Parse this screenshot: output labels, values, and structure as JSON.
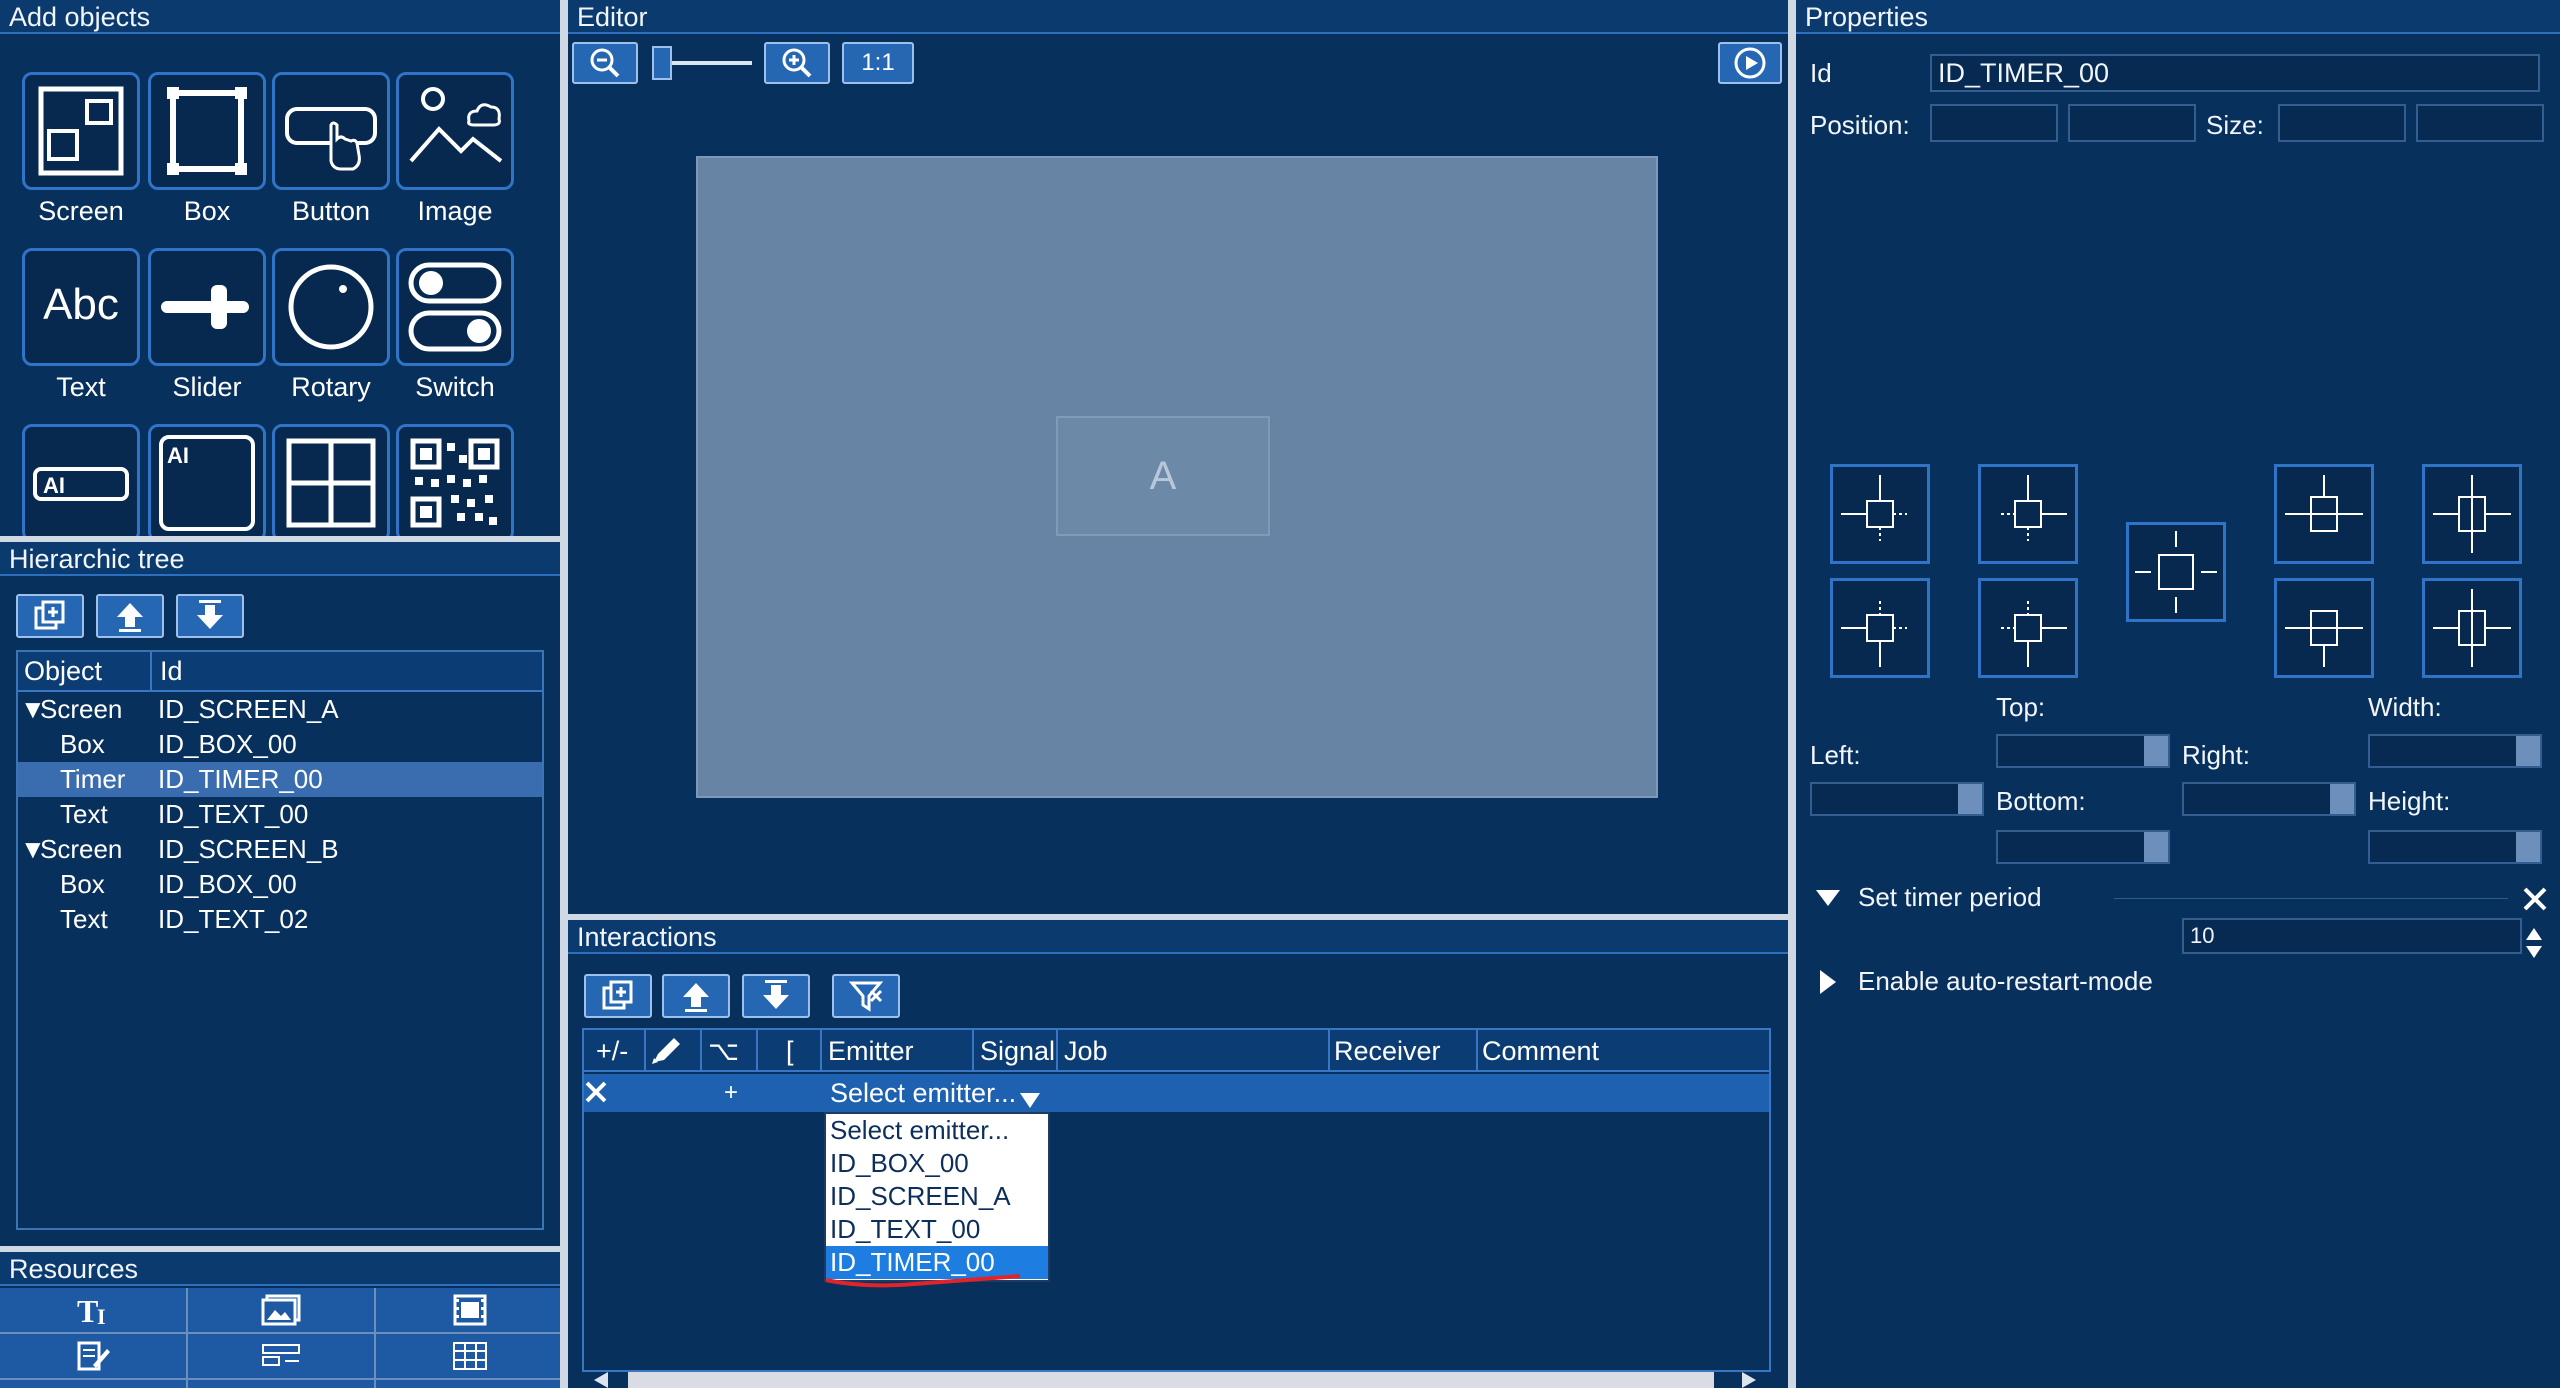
{
  "add_objects": {
    "title": "Add objects",
    "items": [
      {
        "label": "Screen",
        "icon": "screen-icon"
      },
      {
        "label": "Box",
        "icon": "box-icon"
      },
      {
        "label": "Button",
        "icon": "button-icon"
      },
      {
        "label": "Image",
        "icon": "image-icon"
      },
      {
        "label": "Text",
        "icon": "text-abc-icon"
      },
      {
        "label": "Slider",
        "icon": "slider-icon"
      },
      {
        "label": "Rotary",
        "icon": "rotary-icon"
      },
      {
        "label": "Switch",
        "icon": "switch-icon"
      },
      {
        "label": "",
        "icon": "ai-input-icon"
      },
      {
        "label": "",
        "icon": "ai-textbox-icon"
      },
      {
        "label": "",
        "icon": "grid-icon"
      },
      {
        "label": "",
        "icon": "qr-code-icon"
      }
    ]
  },
  "tree": {
    "title": "Hierarchic tree",
    "col_object": "Object",
    "col_id": "Id",
    "rows": [
      {
        "object": "Screen",
        "id": "ID_SCREEN_A"
      },
      {
        "object": "Box",
        "id": "ID_BOX_00"
      },
      {
        "object": "Timer",
        "id": "ID_TIMER_00"
      },
      {
        "object": "Text",
        "id": "ID_TEXT_00"
      },
      {
        "object": "Screen",
        "id": "ID_SCREEN_B"
      },
      {
        "object": "Box",
        "id": "ID_BOX_00"
      },
      {
        "object": "Text",
        "id": "ID_TEXT_02"
      }
    ]
  },
  "resources": {
    "title": "Resources"
  },
  "editor": {
    "title": "Editor",
    "zoom_label": "1:1",
    "canvas_text": "A"
  },
  "interactions": {
    "title": "Interactions",
    "col_plusminus": "+/-",
    "col_bracket": "[",
    "col_emitter": "Emitter",
    "col_signal": "Signal",
    "col_job": "Job",
    "col_receiver": "Receiver",
    "col_comment": "Comment",
    "row_add": "+",
    "emitter_value": "Select emitter...",
    "dropdown_options": [
      "Select emitter...",
      "ID_BOX_00",
      "ID_SCREEN_A",
      "ID_TEXT_00",
      "ID_TIMER_00"
    ],
    "dropdown_selected": "ID_TIMER_00"
  },
  "properties": {
    "title": "Properties",
    "id_label": "Id",
    "id_value": "ID_TIMER_00",
    "position_label": "Position:",
    "size_label": "Size:",
    "top_label": "Top:",
    "width_label": "Width:",
    "left_label": "Left:",
    "right_label": "Right:",
    "bottom_label": "Bottom:",
    "height_label": "Height:",
    "timer_period_label": "Set timer period",
    "timer_period_value": "10",
    "auto_restart_label": "Enable auto-restart-mode"
  }
}
